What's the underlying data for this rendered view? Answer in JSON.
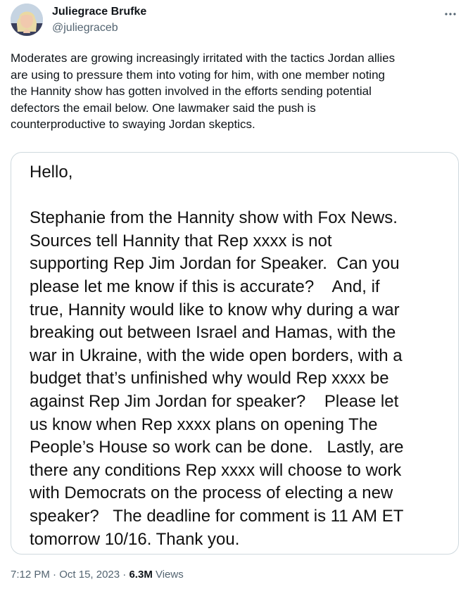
{
  "author": {
    "display_name": "Juliegrace Brufke",
    "handle": "@juliegraceb"
  },
  "tweet": {
    "text": "Moderates are growing increasingly irritated with the tactics Jordan allies\nare using to pressure them into voting for him, with one member noting\nthe Hannity show has gotten involved in the efforts sending potential\ndefectors the email below. One lawmaker said the push is\ncounterproductive to swaying Jordan skeptics."
  },
  "media": {
    "email_text": "Hello,\n\nStephanie from the Hannity show with Fox News.\nSources tell Hannity that Rep xxxx is not\nsupporting Rep Jim Jordan for Speaker.  Can you\nplease let me know if this is accurate?    And, if\ntrue, Hannity would like to know why during a war\nbreaking out between Israel and Hamas, with the\nwar in Ukraine, with the wide open borders, with a\nbudget that’s unfinished why would Rep xxxx be\nagainst Rep Jim Jordan for speaker?    Please let\nus know when Rep xxxx plans on opening The\nPeople’s House so work can be done.   Lastly, are\nthere any conditions Rep xxxx will choose to work\nwith Democrats on the process of electing a new\nspeaker?   The deadline for comment is 11 AM ET\ntomorrow 10/16. Thank you."
  },
  "meta": {
    "time": "7:12 PM",
    "separator": " · ",
    "date": "Oct 15, 2023",
    "views_count": "6.3M",
    "views_label": " Views"
  },
  "icons": {
    "more": "more-horizontal-icon"
  },
  "colors": {
    "text": "#0f1419",
    "secondary": "#536471",
    "border": "#cfd9de"
  }
}
